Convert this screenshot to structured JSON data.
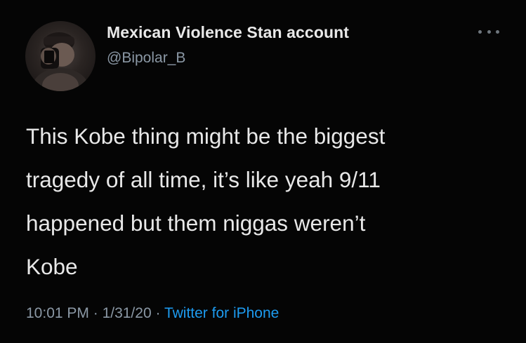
{
  "tweet": {
    "display_name": "Mexican Violence Stan account",
    "handle": "@Bipolar_B",
    "more_icon": "more-horizontal-icon",
    "text_lines": [
      "This Kobe thing might be the biggest",
      "tragedy of all time, it’s like yeah 9/11",
      "happened but them niggas weren’t",
      "Kobe"
    ],
    "time": "10:01 PM",
    "separator": " · ",
    "date": "1/31/20",
    "source": "Twitter for iPhone"
  },
  "colors": {
    "background": "#050505",
    "primary_text": "#e9e9e9",
    "secondary_text": "#8b98a5",
    "link": "#1d9bf0"
  }
}
